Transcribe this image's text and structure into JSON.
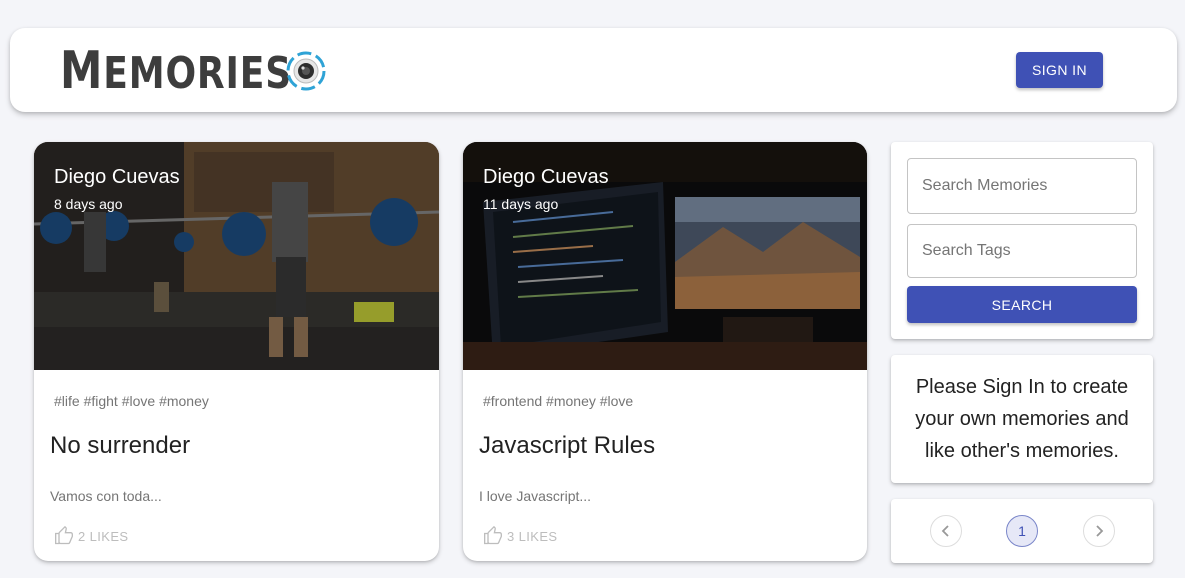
{
  "header": {
    "brand": "Memories",
    "brand_first": "M",
    "brand_rest": "EMORIES",
    "logo": "camera-lens-icon",
    "signin_label": "SIGN IN",
    "accent": "#3f51b5"
  },
  "posts": [
    {
      "author": "Diego Cuevas",
      "time": "8 days ago",
      "tags": "#life #fight #love #money",
      "title": "No surrender",
      "message": "Vamos con toda...",
      "likes": "2 LIKES",
      "image": "gym-weightlifting-photo"
    },
    {
      "author": "Diego Cuevas",
      "time": "11 days ago",
      "tags": "#frontend #money #love",
      "title": "Javascript Rules",
      "message": "I love Javascript...",
      "likes": "3 LIKES",
      "image": "desk-monitors-code-photo"
    }
  ],
  "search": {
    "memories_placeholder": "Search Memories",
    "tags_placeholder": "Search Tags",
    "button_label": "SEARCH"
  },
  "signin_notice": "Please Sign In to create your own memories and like other's memories.",
  "pagination": {
    "current_page": "1",
    "prev_icon": "chevron-left-icon",
    "next_icon": "chevron-right-icon"
  }
}
